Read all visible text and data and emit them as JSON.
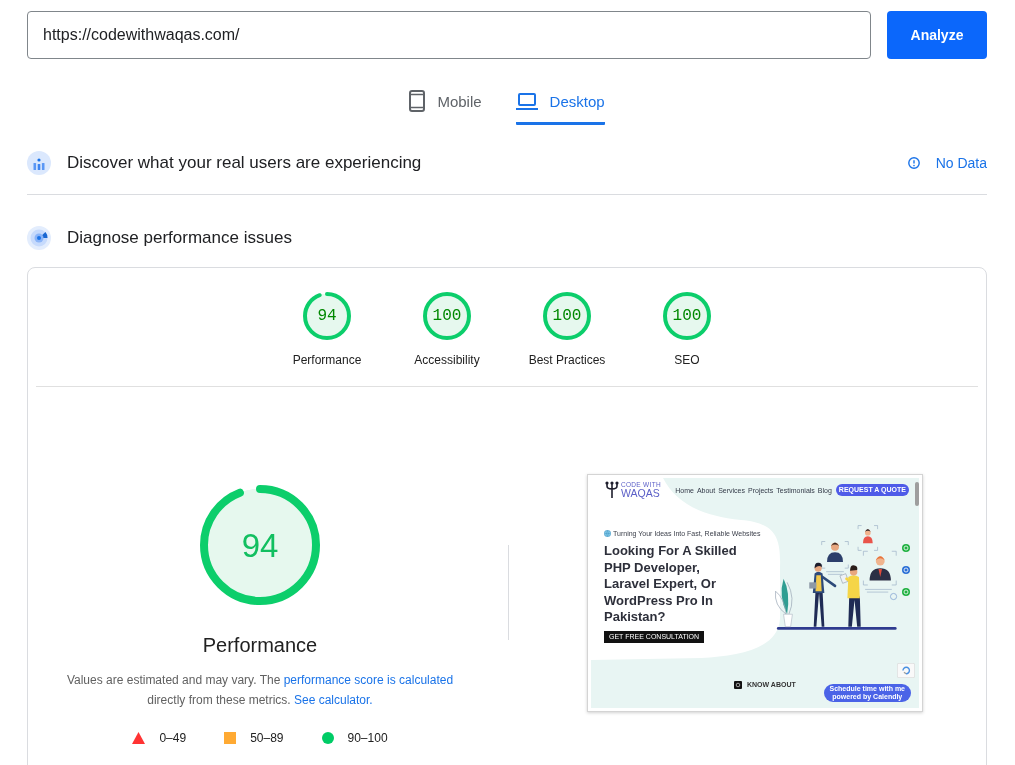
{
  "url_bar": {
    "value": "https://codewithwaqas.com/",
    "button": "Analyze"
  },
  "device_tabs": [
    {
      "kind": "phone",
      "label": "Mobile",
      "selected": false
    },
    {
      "kind": "laptop",
      "label": "Desktop",
      "selected": true
    }
  ],
  "field_data": {
    "title": "Discover what your real users are experiencing",
    "status": "No Data"
  },
  "lab_data": {
    "title": "Diagnose performance issues",
    "categories": [
      {
        "label": "Performance",
        "score": "94",
        "level": 0.94
      },
      {
        "label": "Accessibility",
        "score": "100",
        "level": 1
      },
      {
        "label": "Best Practices",
        "score": "100",
        "level": 1
      },
      {
        "label": "SEO",
        "score": "100",
        "level": 1
      }
    ],
    "focus": {
      "label": "Performance",
      "score": "94",
      "level": 0.94
    },
    "note": [
      {
        "kind": "text",
        "text": "Values are estimated and may vary. The "
      },
      {
        "kind": "link",
        "text": "performance score is calculated"
      },
      {
        "kind": "text",
        "text": " directly from these metrics. "
      },
      {
        "kind": "link",
        "text": "See calculator."
      }
    ],
    "legend": [
      {
        "kind": "triangle",
        "range": "0–49",
        "color": "#ff3333"
      },
      {
        "kind": "square",
        "range": "50–89",
        "color": "#ffaa33"
      },
      {
        "kind": "circle",
        "range": "90–100",
        "color": "#00cc66"
      }
    ],
    "screenshot": {
      "logo": {
        "line_1": "CODE WITH",
        "line_2": "WAQAS"
      },
      "nav": [
        "Home",
        "About",
        "Services",
        "Projects",
        "Testimonials",
        "Blog"
      ],
      "cta": "REQUEST A QUOTE",
      "tagline": "Turning Your Ideas Into Fast, Reliable Websites",
      "heading": "Looking For A Skilled PHP Developer, Laravel Expert, Or WordPress Pro In Pakistan?",
      "button": "GET FREE CONSULTATION",
      "know_about": "KNOW ABOUT",
      "scheduler": {
        "line_1": "Schedule time with me",
        "line_2": "powered by Calendly"
      }
    }
  }
}
